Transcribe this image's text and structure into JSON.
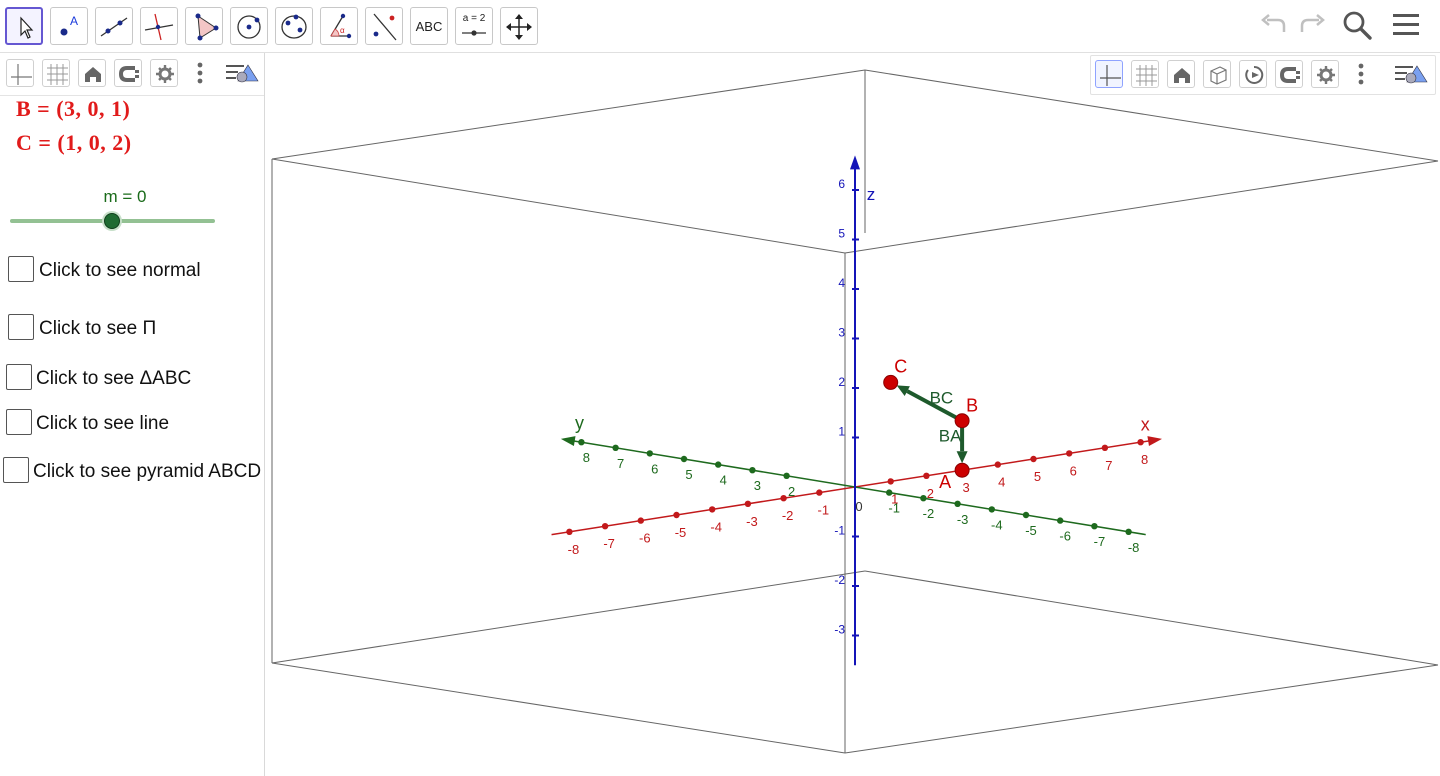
{
  "toolbar": {
    "tools": [
      {
        "name": "move-tool",
        "selected": true
      },
      {
        "name": "point-tool"
      },
      {
        "name": "line-tool"
      },
      {
        "name": "perpendicular-line-tool"
      },
      {
        "name": "polygon-tool"
      },
      {
        "name": "circle-tool"
      },
      {
        "name": "conic-tool"
      },
      {
        "name": "angle-tool"
      },
      {
        "name": "reflect-tool"
      },
      {
        "name": "text-tool",
        "label": "ABC"
      },
      {
        "name": "slider-tool",
        "label": "a = 2"
      },
      {
        "name": "move-view-tool"
      }
    ],
    "right": [
      "undo-icon",
      "redo-icon",
      "search-icon",
      "menu-icon"
    ]
  },
  "algebra": {
    "style_bar": [
      "axes-icon",
      "grid-icon",
      "home-icon",
      "magnet-icon",
      "gear-icon",
      "more-icon",
      "style-bar-toggle-icon"
    ],
    "points": [
      {
        "name": "B",
        "text": "B  =  (3, 0, 1)"
      },
      {
        "name": "C",
        "text": "C  =  (1, 0, 2)"
      }
    ],
    "slider": {
      "label": "m = 0",
      "value": 0
    },
    "checkboxes": [
      {
        "label": "Click to see normal",
        "checked": false
      },
      {
        "label": "Click to see Π",
        "checked": false
      },
      {
        "label": "Click to see ΔABC",
        "checked": false
      },
      {
        "label": "Click to see line",
        "checked": false
      },
      {
        "label": "Click to see pyramid ABCD",
        "checked": false
      }
    ]
  },
  "graphics3d": {
    "style_bar": [
      "axes-icon",
      "grid-icon",
      "home-icon",
      "cube-icon",
      "rotate-icon",
      "magnet-icon",
      "gear-icon",
      "more-icon",
      "style-bar-toggle-icon"
    ],
    "axis_labels": {
      "x": "x",
      "y": "y",
      "z": "z"
    },
    "x_ticks": [
      "-8",
      "-7",
      "-6",
      "-5",
      "-4",
      "-3",
      "-2",
      "-1",
      "1",
      "2",
      "3",
      "4",
      "5",
      "6",
      "7",
      "8"
    ],
    "y_ticks": [
      "8",
      "7",
      "6",
      "5",
      "4",
      "3",
      "2",
      "-1",
      "-2",
      "-3",
      "-4",
      "-5",
      "-6",
      "-7",
      "-8"
    ],
    "z_ticks": [
      "6",
      "5",
      "4",
      "3",
      "2",
      "1",
      "-1",
      "-2",
      "-3"
    ],
    "origin_label": "0",
    "points": [
      "A",
      "B",
      "C"
    ],
    "vectors": [
      "BC",
      "BA"
    ],
    "colors": {
      "x_axis": "#c2191b",
      "y_axis": "#1e6a1e",
      "z_axis": "#1414b8",
      "point": "#cc0000",
      "vector": "#1e5a2c"
    }
  }
}
